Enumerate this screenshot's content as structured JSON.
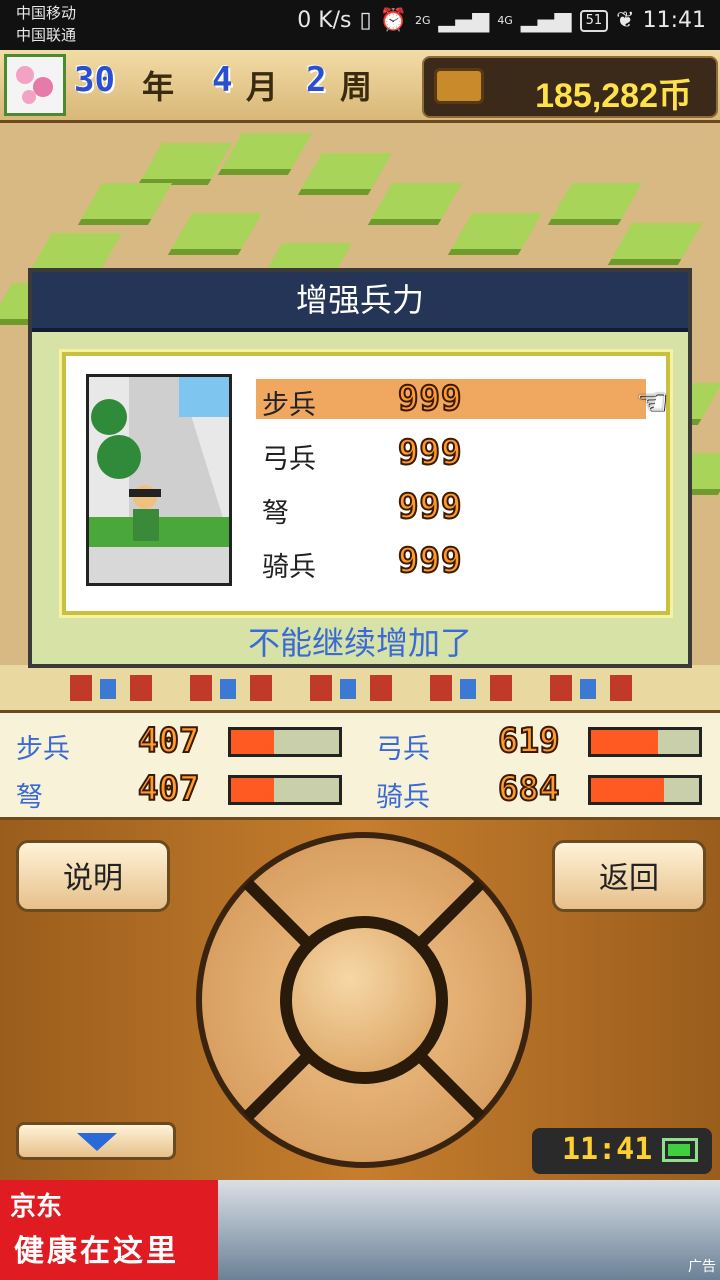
{
  "status_bar": {
    "carrier1": "中国移动",
    "carrier2": "中国联通",
    "net_speed": "0 K/s",
    "signal_2g": "2G",
    "signal_4g": "4G",
    "battery": "51",
    "time": "11:41"
  },
  "header": {
    "year": "30",
    "year_unit": "年",
    "month": "4",
    "month_unit": "月",
    "week": "2",
    "week_unit": "周",
    "gold": "185,282币"
  },
  "dialog": {
    "title": "增强兵力",
    "units": [
      {
        "label": "步兵",
        "value": "999"
      },
      {
        "label": "弓兵",
        "value": "999"
      },
      {
        "label": "弩",
        "value": "999"
      },
      {
        "label": "骑兵",
        "value": "999"
      }
    ],
    "selected_index": 0,
    "notice": "不能继续增加了"
  },
  "troops": [
    {
      "label": "步兵",
      "value": "407",
      "fill": 0.4
    },
    {
      "label": "弓兵",
      "value": "619",
      "fill": 0.62
    },
    {
      "label": "弩",
      "value": "407",
      "fill": 0.4
    },
    {
      "label": "骑兵",
      "value": "684",
      "fill": 0.68
    }
  ],
  "controls": {
    "explain_label": "说明",
    "back_label": "返回",
    "game_clock": "11:41"
  },
  "ad": {
    "logo": "京东",
    "text": "健康在这里",
    "tag": "广告"
  },
  "colors": {
    "accent_blue": "#3a6ad6",
    "selected_row": "#f0a860",
    "gold_text": "#ffe24a",
    "bar_fill": "#ff5a22"
  }
}
